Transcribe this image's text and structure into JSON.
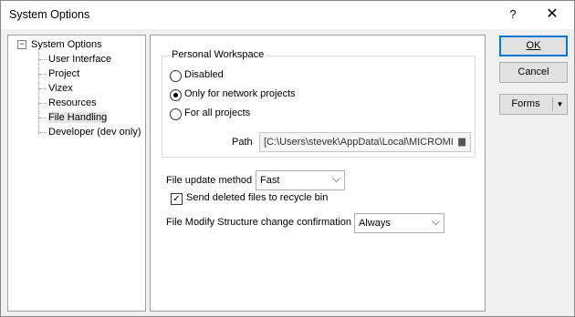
{
  "window": {
    "title": "System Options",
    "help_glyph": "?",
    "close_glyph": "✕"
  },
  "tree": {
    "root_label": "System Options",
    "expander_glyph": "−",
    "items": [
      {
        "label": "User Interface"
      },
      {
        "label": "Project"
      },
      {
        "label": "Vizex"
      },
      {
        "label": "Resources"
      },
      {
        "label": "File Handling",
        "selected": true
      },
      {
        "label": "Developer (dev only)"
      }
    ]
  },
  "workspace": {
    "group_title": "Personal Workspace",
    "options": [
      {
        "label": "Disabled",
        "checked": false
      },
      {
        "label": "Only for network projects",
        "checked": true
      },
      {
        "label": "For all projects",
        "checked": false
      }
    ],
    "path_label": "Path",
    "path_value": "[C:\\Users\\stevek\\AppData\\Local\\MICROMI"
  },
  "file_update": {
    "label": "File update method",
    "value": "Fast"
  },
  "recycle": {
    "label": "Send deleted files to recycle bin",
    "checked": true,
    "check_glyph": "✓"
  },
  "modify": {
    "label": "File Modify Structure change confirmation",
    "value": "Always"
  },
  "buttons": {
    "ok": "OK",
    "cancel": "Cancel",
    "forms": "Forms"
  },
  "icons": {
    "dropdown": "⌵",
    "split_arrow": "▼",
    "folder": "▆"
  }
}
